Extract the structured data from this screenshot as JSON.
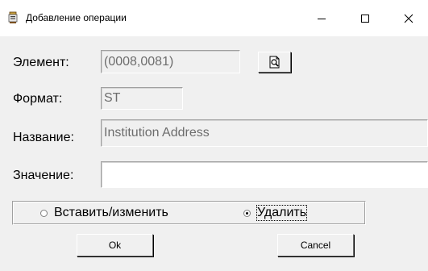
{
  "window": {
    "title": "Добавление операции",
    "icons": {
      "app": "app-icon",
      "minimize": "minimize-icon",
      "maximize": "maximize-icon",
      "close": "close-icon"
    }
  },
  "form": {
    "element_label": "Элемент:",
    "element_value": "(0008,0081)",
    "browse_icon": "magnifier-document-icon",
    "format_label": "Формат:",
    "format_value": "ST",
    "name_label": "Название:",
    "name_value": "Institution Address",
    "value_label": "Значение:",
    "value_value": ""
  },
  "operation": {
    "options": [
      {
        "label": "Вставить/изменить",
        "checked": false
      },
      {
        "label": "Удалить",
        "checked": true
      }
    ]
  },
  "buttons": {
    "ok_label": "Ok",
    "cancel_label": "Cancel"
  }
}
